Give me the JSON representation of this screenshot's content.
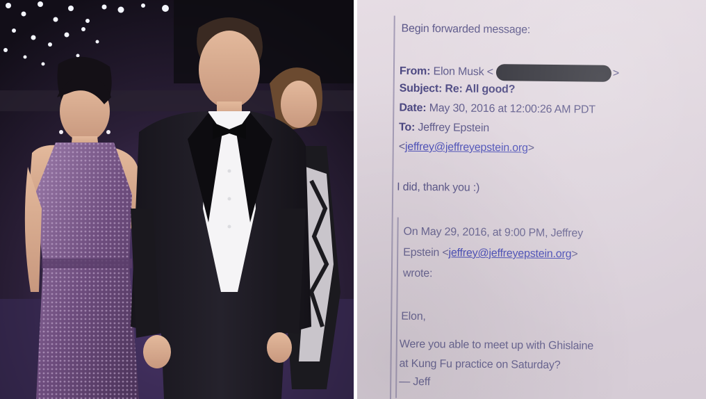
{
  "email": {
    "forward_header": "Begin forwarded message:",
    "from_label": "From:",
    "from_value": "Elon Musk <",
    "from_close": ">",
    "subject_label": "Subject:",
    "subject_value": "Re: All good?",
    "date_label": "Date:",
    "date_value": "May 30, 2016 at 12:00:26 AM PDT",
    "to_label": "To:",
    "to_value": "Jeffrey Epstein",
    "to_email_open": "<",
    "to_email": "jeffrey@jeffreyepstein.org",
    "to_email_close": ">",
    "reply_body": "I did, thank you :)",
    "quoted_header_1": "On May 29, 2016, at 9:00 PM, Jeffrey",
    "quoted_header_2a": "Epstein <",
    "quoted_email": "jeffrey@jeffreyepstein.org",
    "quoted_header_2b": ">",
    "quoted_header_3": "wrote:",
    "quoted_greeting": "Elon,",
    "quoted_body_1": "Were you able to meet up with Ghislaine",
    "quoted_body_2": "at Kung Fu practice on Saturday?",
    "quoted_signoff": "— Jeff"
  },
  "colors": {
    "paper": "#ddd3dc",
    "ink": "#5a5688",
    "link": "#4b4fb8",
    "redaction": "#2e2e36"
  }
}
